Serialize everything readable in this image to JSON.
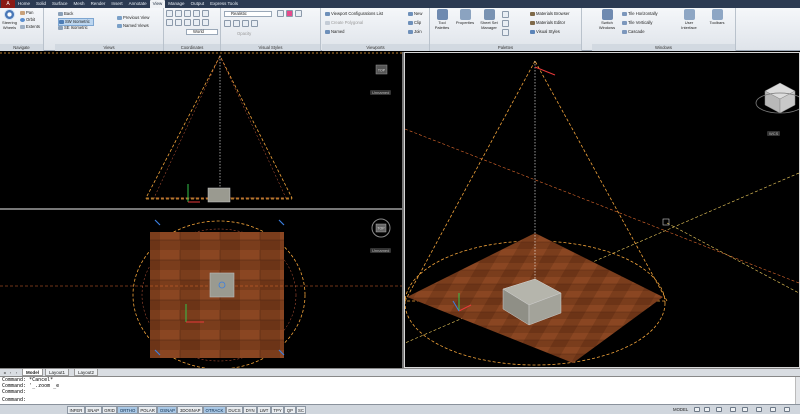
{
  "app_button": "A",
  "tabs": [
    "Home",
    "Solid",
    "Surface",
    "Mesh",
    "Render",
    "Insert",
    "Annotate",
    "View",
    "Manage",
    "Output",
    "Express Tools"
  ],
  "active_tab": "View",
  "ribbon": {
    "navigate": {
      "title": "Navigate",
      "steering": "Steering\nWheels",
      "pan": "Pan",
      "orbit": "Orbit",
      "extents": "Extents"
    },
    "views": {
      "title": "Views",
      "items": [
        "Back",
        "SW Isometric",
        "SE Isometric"
      ],
      "previous_view": "Previous View",
      "named_views": "Named Views"
    },
    "coordinates": {
      "title": "Coordinates",
      "ucs_dropdown": "World"
    },
    "visual_styles": {
      "title": "Visual Styles",
      "style_dropdown": "Realistic",
      "opacity_label": "Opacity"
    },
    "viewports": {
      "title": "Viewports",
      "config_list": "Viewport Configurations List",
      "create_polygonal": "Create Polygonal",
      "named": "Named",
      "new": "New",
      "clip": "Clip",
      "join": "Join"
    },
    "palettes": {
      "title": "Palettes",
      "tool_palettes": "Tool\nPalettes",
      "properties": "Properties",
      "sheet_set_manager": "Sheet Set\nManager",
      "materials_browser": "Materials Browser",
      "materials_editor": "Materials Editor",
      "visual_styles": "Visual Styles"
    },
    "windows": {
      "title": "Windows",
      "switch_windows": "Switch\nWindows",
      "tile_horizontally": "Tile Horizontally",
      "tile_vertically": "Tile Vertically",
      "cascade": "Cascade",
      "user_interface": "User\nInterface",
      "toolbars": "Toolbars"
    }
  },
  "viewports": {
    "top_label": "Unnamed",
    "left_label": "Unnamed",
    "right_label": "WCS",
    "top_viewcube": "TOP",
    "left_viewcube": "TOP"
  },
  "layout_tabs": [
    "Model",
    "Layout1",
    "Layout2"
  ],
  "active_layout": "Model",
  "command_lines": [
    "Command: *Cancel*",
    "Command: '_.zoom _e",
    "Command:",
    "Command:"
  ],
  "status_toggles": [
    {
      "label": "INFER",
      "on": false
    },
    {
      "label": "SNAP",
      "on": false
    },
    {
      "label": "GRID",
      "on": false
    },
    {
      "label": "ORTHO",
      "on": true
    },
    {
      "label": "POLAR",
      "on": false
    },
    {
      "label": "OSNAP",
      "on": true
    },
    {
      "label": "3DOSNAP",
      "on": false
    },
    {
      "label": "OTRACK",
      "on": true
    },
    {
      "label": "DUCS",
      "on": false
    },
    {
      "label": "DYN",
      "on": false
    },
    {
      "label": "LWT",
      "on": false
    },
    {
      "label": "TPY",
      "on": false
    },
    {
      "label": "QP",
      "on": false
    },
    {
      "label": "SC",
      "on": false
    }
  ],
  "model_label": "MODEL",
  "colors": {
    "ribbon_tab_bg": "#2b3a52",
    "wood": "#7a3d1c",
    "wood_dark": "#4e2410",
    "light_cone": "#f3a43a",
    "ucs_x": "#e8393a",
    "ucs_y": "#35c24a",
    "ucs_z": "#3a7fe0"
  }
}
